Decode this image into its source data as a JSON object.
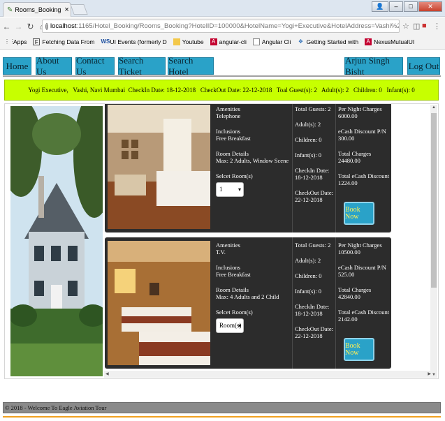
{
  "browser": {
    "tab_title": "Rooms_Booking - My Fir",
    "url_host": "localhost",
    "url_path": ":1165/Hotel_Booking/Rooms_Booking?HotelID=100000&HotelName=Yogi+Executive&HotelAddress=Vashi%2C+Navi+Mumbai&HotelAminities...",
    "bookmarks": [
      {
        "icon": "apps-icon",
        "label": "Apps"
      },
      {
        "icon": "fetching-data-icon",
        "label": "Fetching Data From"
      },
      {
        "icon": "ws-icon",
        "label": "UI Events (formerly D"
      },
      {
        "icon": "youtube-icon",
        "label": "Youtube"
      },
      {
        "icon": "angular-icon",
        "label": "angular-cli"
      },
      {
        "icon": "doc-icon",
        "label": "Angular Cli"
      },
      {
        "icon": "getting-started-icon",
        "label": "Getting Started with"
      },
      {
        "icon": "angular-icon",
        "label": "NexusMutualUI"
      }
    ]
  },
  "nav": {
    "home": "Home",
    "about": "About Us",
    "contact": "Contact Us",
    "search_ticket": "Search Ticket",
    "search_hotel": "Search Hotel",
    "user": "Arjun Singh Bisht",
    "logout": "Log Out"
  },
  "info": {
    "text": "Yogi Executive,   Vashi, Navi Mumbai  CheckIn Date: 18-12-2018   CheckOut Date: 22-12-2018   Toal Guest(s): 2   Adult(s): 2   Children: 0   Infant(s): 0"
  },
  "rooms": [
    {
      "amenities_label": "Amenities",
      "amenities": "Telephone",
      "inclusions_label": "Inclusions",
      "inclusions": "Free Breakfast",
      "details_label": "Room Details",
      "details": "Max: 2 Adults, Window Scene",
      "select_label": "Selcet Room(s)",
      "select_value": "1",
      "total_guests": "Total Guests: 2",
      "adults": "Adult(s): 2",
      "children": "Children: 0",
      "infants": "Infant(s): 0",
      "checkin_label": "CheckIn Date:",
      "checkin": "18-12-2018",
      "checkout_label": "CheckOut Date:",
      "checkout": "22-12-2018",
      "per_night_label": "Per Night Charges",
      "per_night": "6000.00",
      "discount_label": "eCash Discount P/N",
      "discount": "300.00",
      "total_label": "Total Charges",
      "total": "24480.00",
      "total_discount_label": "Total eCash Discount",
      "total_discount": "1224.00",
      "book": "Book Now"
    },
    {
      "amenities_label": "Amenities",
      "amenities": "T.V.",
      "inclusions_label": "Inclusions",
      "inclusions": "Free Breakfast",
      "details_label": "Room Details",
      "details": "Max: 4 Adults and 2 Child",
      "select_label": "Selcet Room(s)",
      "select_value": "Room(s)",
      "total_guests": "Total Guests: 2",
      "adults": "Adult(s): 2",
      "children": "Children: 0",
      "infants": "Infant(s): 0",
      "checkin_label": "CheckIn Date:",
      "checkin": "18-12-2018",
      "checkout_label": "CheckOut Date:",
      "checkout": "22-12-2018",
      "per_night_label": "Per Night Charges",
      "per_night": "10500.00",
      "discount_label": "eCash Discount P/N",
      "discount": "525.00",
      "total_label": "Total Charges",
      "total": "42840.00",
      "total_discount_label": "Total eCash Discount",
      "total_discount": "2142.00",
      "book": "Book Now"
    }
  ],
  "footer": {
    "text": "© 2018 - Welcome To Eagle Aviation Tour"
  },
  "colors": {
    "nav_button": "#2aa2c8",
    "info_bar": "#c7ff00",
    "card_bg": "#2c2c2c",
    "book_text": "#ffee55"
  }
}
